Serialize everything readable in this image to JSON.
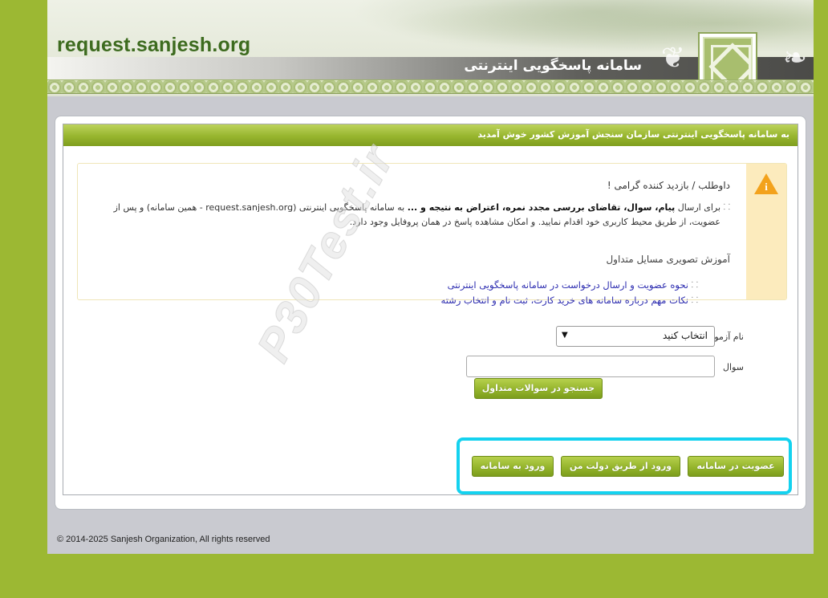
{
  "header": {
    "site_name": "request.sanjesh.org",
    "subtitle": "سامانه پاسخگویی اینترنتی"
  },
  "card": {
    "title": "به سامانه پاسخگویی اینترنتی سازمان سنجش آموزش کشور خوش آمدید"
  },
  "notice": {
    "greeting": "داوطلب / بازدید کننده گرامی !",
    "intro_prefix": "برای ارسال ",
    "intro_bold": "پیام، سوال، تقاضای بررسی مجدد نمره، اعتراض به نتیجه و ...",
    "intro_suffix": " به سامانه پاسخگویی اینترنتی (request.sanjesh.org - همین سامانه) و پس از عضویت، از طریق محیط کاربری خود اقدام نمایید. و امکان مشاهده پاسخ در همان پروفایل وجود دارد.",
    "faq_title": "آموزش تصویری مسایل متداول",
    "faq_links": [
      "نحوه عضویت و ارسال درخواست در سامانه پاسخگویی اینترنتی",
      "نکات مهم درباره سامانه های خرید کارت، ثبت نام و انتخاب رشته"
    ]
  },
  "form": {
    "exam_label": "نام آزمون",
    "exam_selected": "انتخاب کنید",
    "question_label": "سوال",
    "question_value": "",
    "search_button": "جستجو در سوالات متداول"
  },
  "actions": {
    "register": "عضویت در سامانه",
    "gov_login": "ورود از طریق دولت من",
    "login": "ورود به سامانه"
  },
  "watermark": "P30Test.ir",
  "footer": "© 2014-2025 Sanjesh Organization, All rights reserved",
  "colors": {
    "background": "#9cb833",
    "accent_green": "#95b52c",
    "highlight": "#14d2ef",
    "link": "#2c2cb0",
    "notice_strip": "#fcebbd"
  }
}
